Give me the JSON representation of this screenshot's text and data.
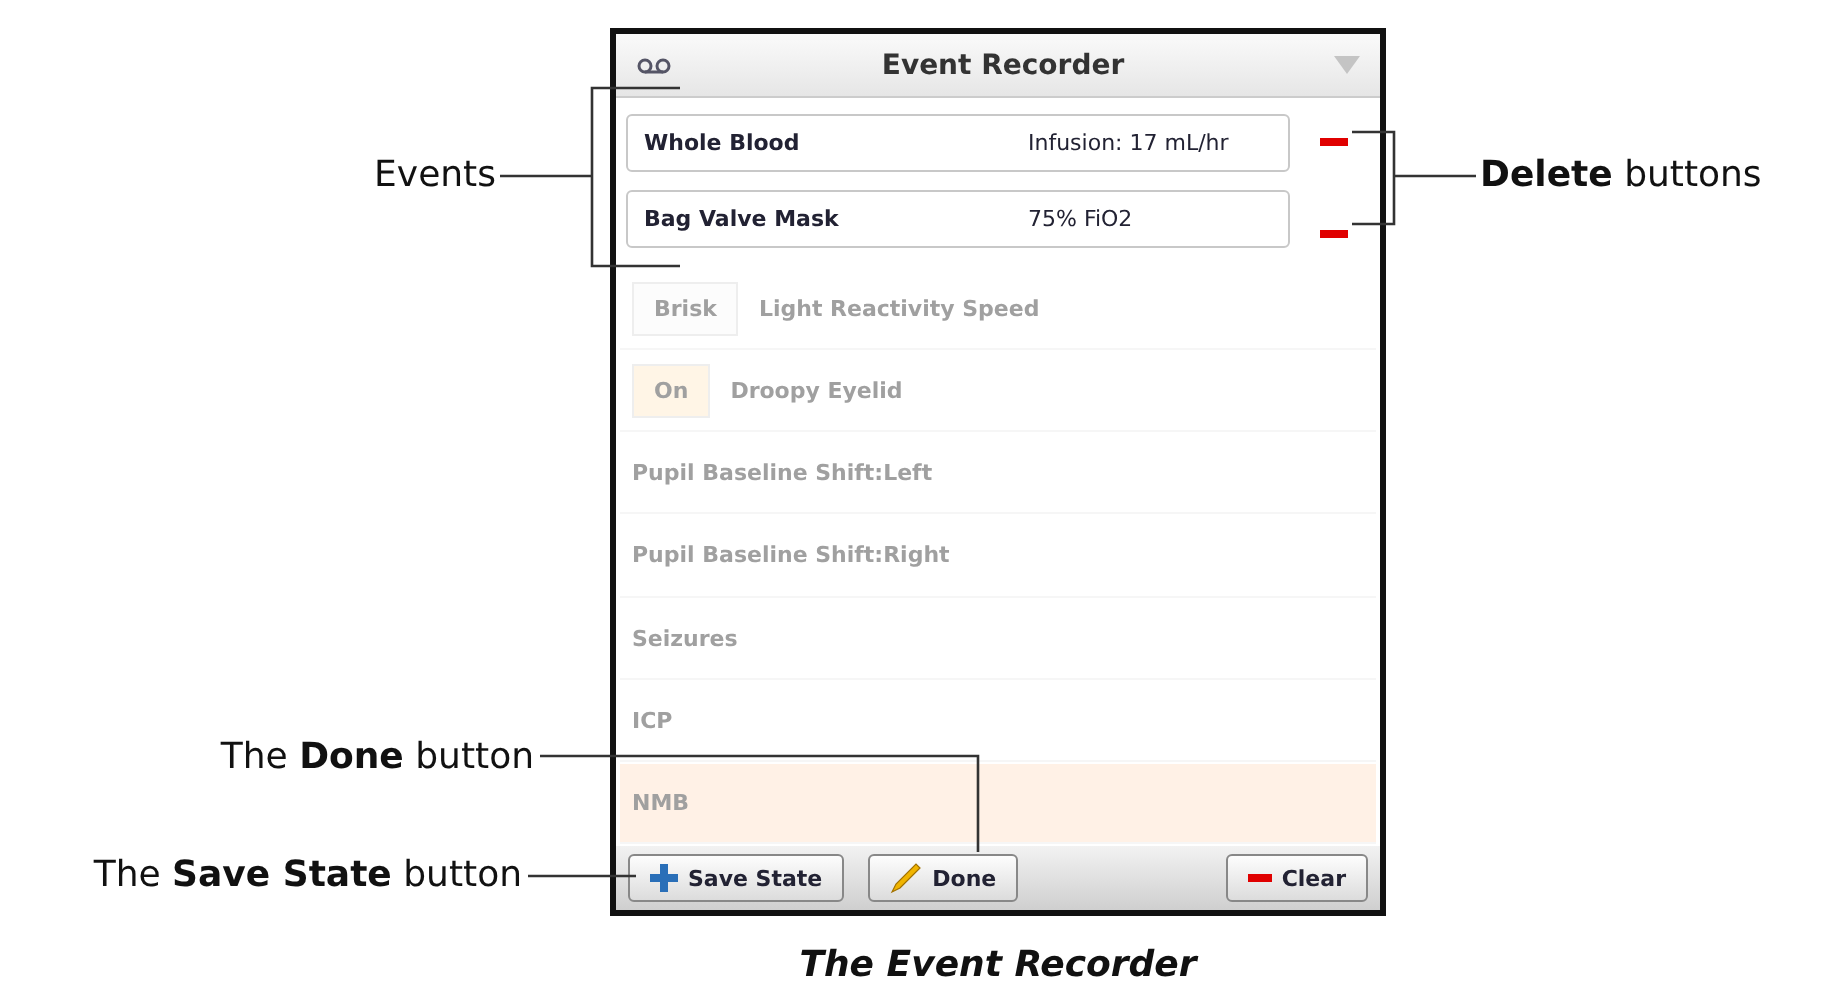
{
  "panel": {
    "title": "Event Recorder",
    "background_rows": [
      {
        "kind": "speed",
        "option": "Brisk",
        "label": "Light Reactivity Speed",
        "highlighted": false
      },
      {
        "kind": "toggle",
        "option": "On",
        "label": "Droopy Eyelid",
        "highlighted": false
      },
      {
        "kind": "plain",
        "label": "Pupil Baseline Shift:Left",
        "highlighted": false
      },
      {
        "kind": "plain",
        "label": "Pupil Baseline Shift:Right",
        "highlighted": false
      },
      {
        "kind": "plain",
        "label": "Seizures",
        "highlighted": false
      },
      {
        "kind": "plain",
        "label": "ICP",
        "highlighted": false
      },
      {
        "kind": "plain",
        "label": "NMB",
        "highlighted": true
      }
    ],
    "events": [
      {
        "name": "Whole Blood",
        "value": "Infusion: 17 mL/hr"
      },
      {
        "name": "Bag Valve Mask",
        "value": "75% FiO2"
      }
    ],
    "footer_buttons": [
      {
        "kind": "add",
        "label": "Save State"
      },
      {
        "kind": "edit",
        "label": "Done"
      },
      {
        "kind": "remove",
        "label": "Clear"
      }
    ]
  },
  "callouts": [
    {
      "text": "Events"
    },
    {
      "text": "**Delete** buttons"
    },
    {
      "text": "The **Done** button"
    },
    {
      "text": "The **Save State** button"
    }
  ],
  "caption": "The Event Recorder"
}
